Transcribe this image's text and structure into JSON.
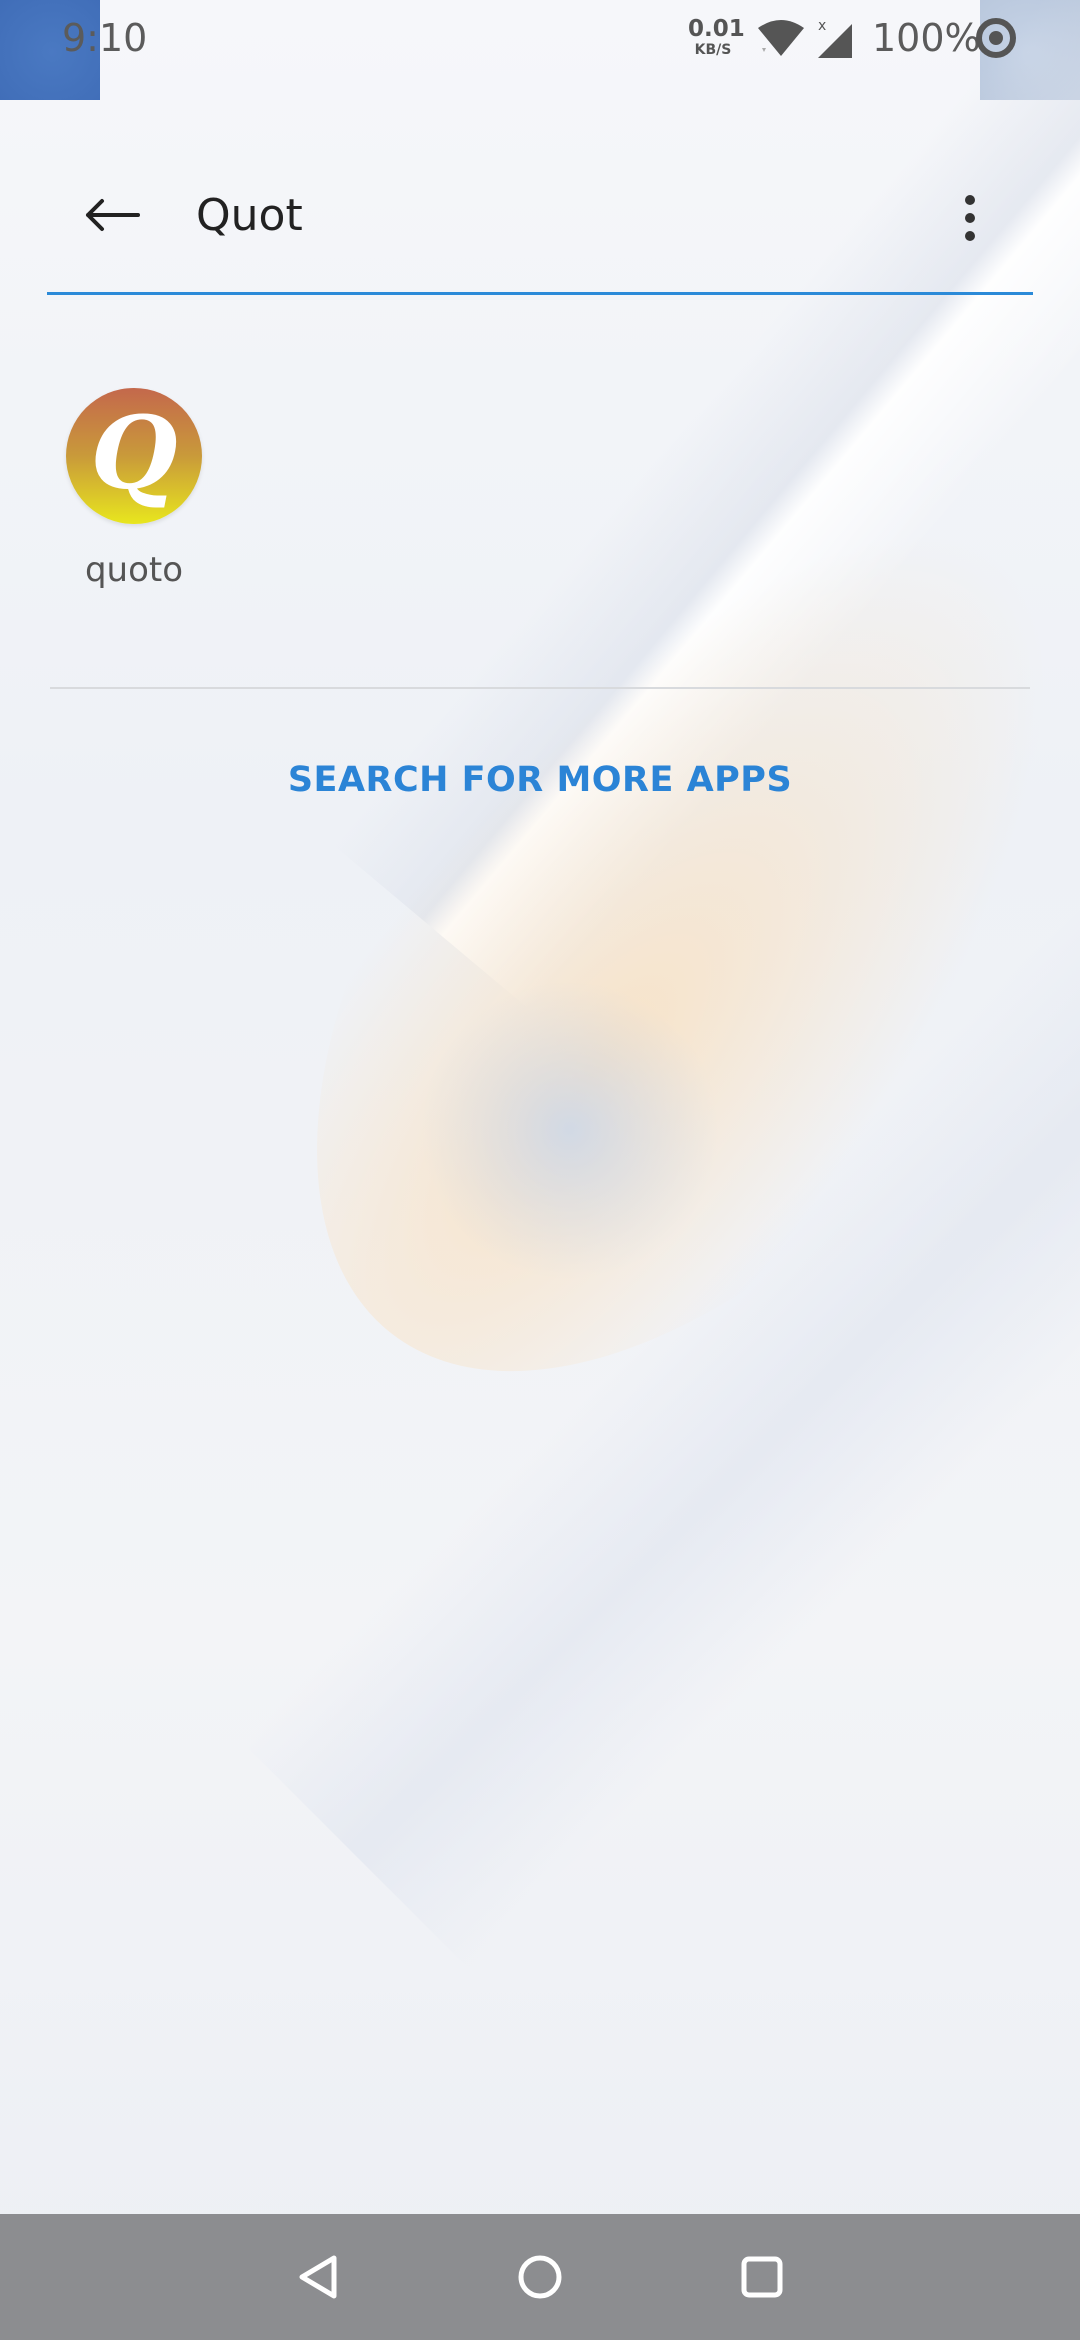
{
  "status_bar": {
    "time": "9:10",
    "net_speed_value": "0.01",
    "net_speed_unit": "KB/S",
    "wifi_icon": "wifi-icon",
    "signal_icon": "signal-no-data-icon",
    "battery_percent": "100%",
    "battery_icon": "battery-ring-icon"
  },
  "search": {
    "query": "Quot",
    "back_icon": "arrow-back-icon",
    "more_icon": "more-vert-icon",
    "accent_color": "#2b8ad8"
  },
  "results": [
    {
      "label": "quoto",
      "icon_letter": "Q"
    }
  ],
  "more_apps": {
    "label": "SEARCH FOR MORE APPS",
    "color": "#2b84d6"
  },
  "nav_bar": {
    "back": "nav-back-icon",
    "home": "nav-home-icon",
    "recents": "nav-recents-icon"
  }
}
